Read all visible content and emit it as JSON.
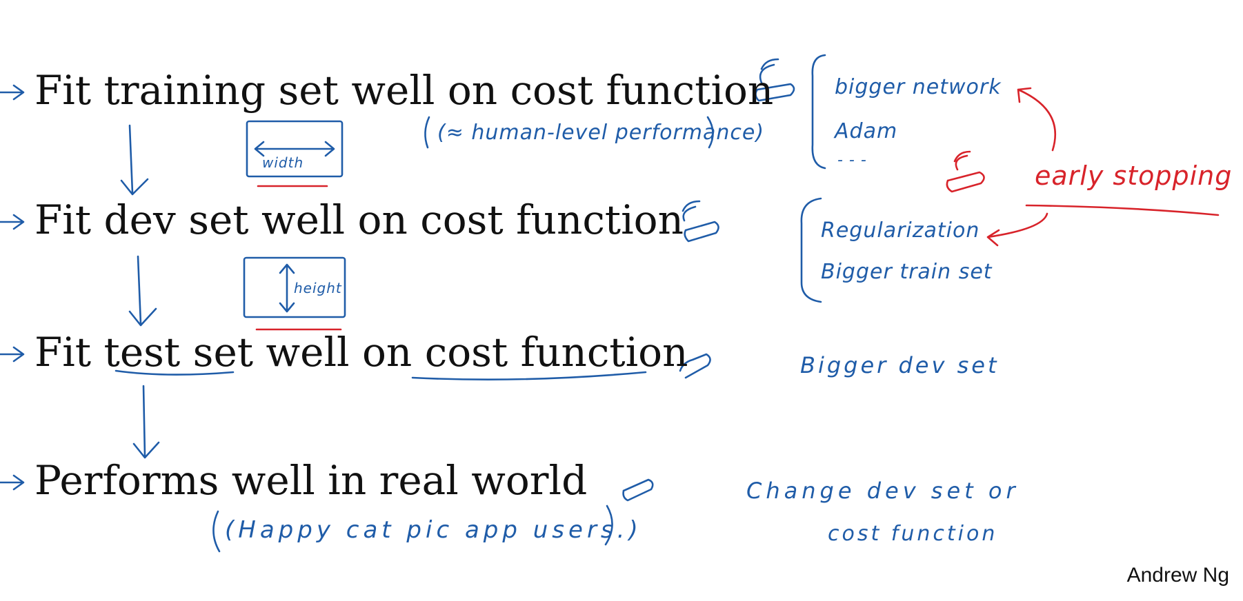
{
  "steps": [
    "Fit training set well on cost function",
    "Fit dev set well on cost function",
    "Fit test set well on cost function",
    "Performs well in real world"
  ],
  "annotations": {
    "human_level": "(≈ human-level performance)",
    "width_label": "width",
    "height_label": "height",
    "real_world_note": "(Happy cat pic app users.)",
    "knob_1_options": [
      "bigger network",
      "Adam",
      "- - -"
    ],
    "early_stopping": "early stopping",
    "knob_2_options": [
      "Regularization",
      "Bigger train set"
    ],
    "knob_3_option": "Bigger dev set",
    "knob_4_option": [
      "Change dev set or",
      "cost function"
    ]
  },
  "credit": "Andrew Ng",
  "colors": {
    "ink_blue": "#1f5ca8",
    "ink_red": "#d8232a",
    "text": "#111111"
  }
}
